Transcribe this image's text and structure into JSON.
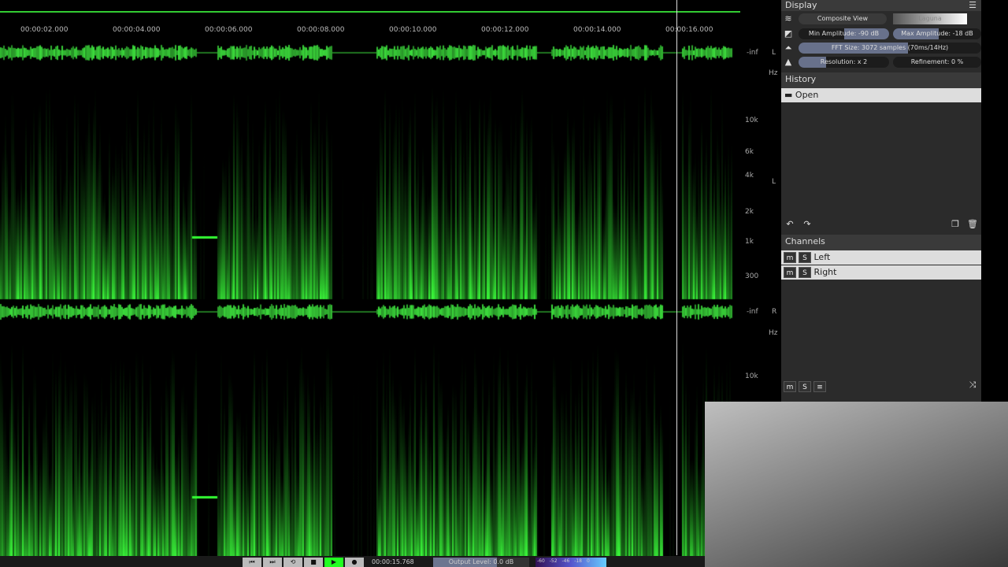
{
  "timeline": {
    "ticks": [
      "00:00:02.000",
      "00:00:04.000",
      "00:00:06.000",
      "00:00:08.000",
      "00:00:10.000",
      "00:00:12.000",
      "00:00:14.000",
      "00:00:16.000"
    ]
  },
  "axis": {
    "inf": "-inf",
    "hz": "Hz",
    "left": "L",
    "right": "R",
    "freqs": [
      "10k",
      "6k",
      "4k",
      "2k",
      "1k",
      "300"
    ]
  },
  "display": {
    "title": "Display",
    "view": "Composite View",
    "colormap": "Laguna",
    "min_amp": "Min Amplitude: -90 dB",
    "max_amp": "Max Amplitude: -18 dB",
    "fft": "FFT Size: 3072 samples (70ms/14Hz)",
    "resolution": "Resolution: x 2",
    "refinement": "Refinement: 0 %"
  },
  "history": {
    "title": "History",
    "items": [
      "Open"
    ]
  },
  "channels": {
    "title": "Channels",
    "items": [
      "Left",
      "Right"
    ],
    "m": "m",
    "s": "S"
  },
  "transport": {
    "time": "00:00:15.768",
    "output": "Output Level: 0.0 dB",
    "meter": [
      "-60",
      "-52",
      "-46",
      "-18",
      "0"
    ]
  },
  "colors": {
    "spectro": "#33ff33",
    "accent": "#7c87a8"
  }
}
